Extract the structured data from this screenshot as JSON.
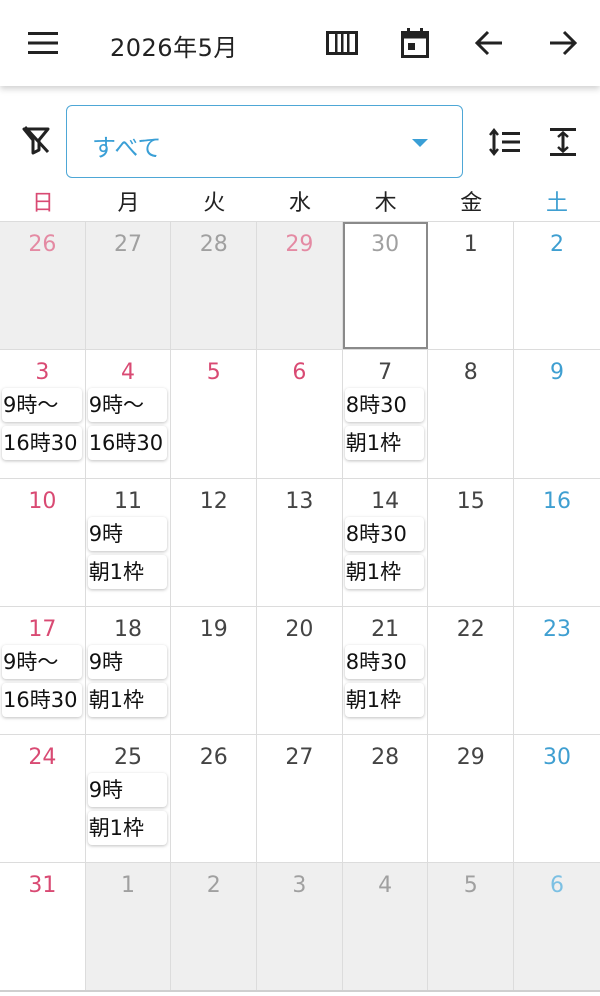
{
  "appbar": {
    "title": "2026年5月",
    "icons": [
      "menu-icon",
      "view-week-icon",
      "calendar-today-icon",
      "arrow-left-icon",
      "arrow-right-icon"
    ]
  },
  "filter": {
    "selected": "すべて",
    "icons": [
      "filter-clear-icon",
      "sort-lines-icon",
      "expand-vertical-icon"
    ]
  },
  "weekdays": [
    "日",
    "月",
    "火",
    "水",
    "木",
    "金",
    "土"
  ],
  "colors": {
    "sunday": "#d94a73",
    "saturday": "#3f9fd1",
    "accent": "#3a9fd6"
  },
  "weeks": [
    {
      "days": [
        {
          "day": "26",
          "other": true,
          "color": "sun",
          "events": []
        },
        {
          "day": "27",
          "other": true,
          "events": []
        },
        {
          "day": "28",
          "other": true,
          "events": []
        },
        {
          "day": "29",
          "other": true,
          "color": "sun",
          "events": []
        },
        {
          "day": "30",
          "other": true,
          "today": true,
          "events": []
        },
        {
          "day": "1",
          "events": []
        },
        {
          "day": "2",
          "color": "sat",
          "events": []
        }
      ]
    },
    {
      "days": [
        {
          "day": "3",
          "color": "sun",
          "events": [
            "9時〜",
            "16時30"
          ]
        },
        {
          "day": "4",
          "color": "hol",
          "events": [
            "9時〜",
            "16時30"
          ]
        },
        {
          "day": "5",
          "color": "hol",
          "events": []
        },
        {
          "day": "6",
          "color": "hol",
          "events": []
        },
        {
          "day": "7",
          "events": [
            "8時30",
            "朝1枠"
          ]
        },
        {
          "day": "8",
          "events": []
        },
        {
          "day": "9",
          "color": "sat",
          "events": []
        }
      ]
    },
    {
      "days": [
        {
          "day": "10",
          "color": "sun",
          "events": []
        },
        {
          "day": "11",
          "events": [
            "9時",
            "朝1枠"
          ]
        },
        {
          "day": "12",
          "events": []
        },
        {
          "day": "13",
          "events": []
        },
        {
          "day": "14",
          "events": [
            "8時30",
            "朝1枠"
          ]
        },
        {
          "day": "15",
          "events": []
        },
        {
          "day": "16",
          "color": "sat",
          "events": []
        }
      ]
    },
    {
      "days": [
        {
          "day": "17",
          "color": "sun",
          "events": [
            "9時〜",
            "16時30"
          ]
        },
        {
          "day": "18",
          "events": [
            "9時",
            "朝1枠"
          ]
        },
        {
          "day": "19",
          "events": []
        },
        {
          "day": "20",
          "events": []
        },
        {
          "day": "21",
          "events": [
            "8時30",
            "朝1枠"
          ]
        },
        {
          "day": "22",
          "events": []
        },
        {
          "day": "23",
          "color": "sat",
          "events": []
        }
      ]
    },
    {
      "days": [
        {
          "day": "24",
          "color": "sun",
          "events": []
        },
        {
          "day": "25",
          "events": [
            "9時",
            "朝1枠"
          ]
        },
        {
          "day": "26",
          "events": []
        },
        {
          "day": "27",
          "events": []
        },
        {
          "day": "28",
          "events": []
        },
        {
          "day": "29",
          "events": []
        },
        {
          "day": "30",
          "color": "sat",
          "events": []
        }
      ]
    },
    {
      "days": [
        {
          "day": "31",
          "color": "sun",
          "events": []
        },
        {
          "day": "1",
          "other": true,
          "events": []
        },
        {
          "day": "2",
          "other": true,
          "events": []
        },
        {
          "day": "3",
          "other": true,
          "events": []
        },
        {
          "day": "4",
          "other": true,
          "events": []
        },
        {
          "day": "5",
          "other": true,
          "events": []
        },
        {
          "day": "6",
          "other": true,
          "color": "sat",
          "events": []
        }
      ]
    }
  ]
}
